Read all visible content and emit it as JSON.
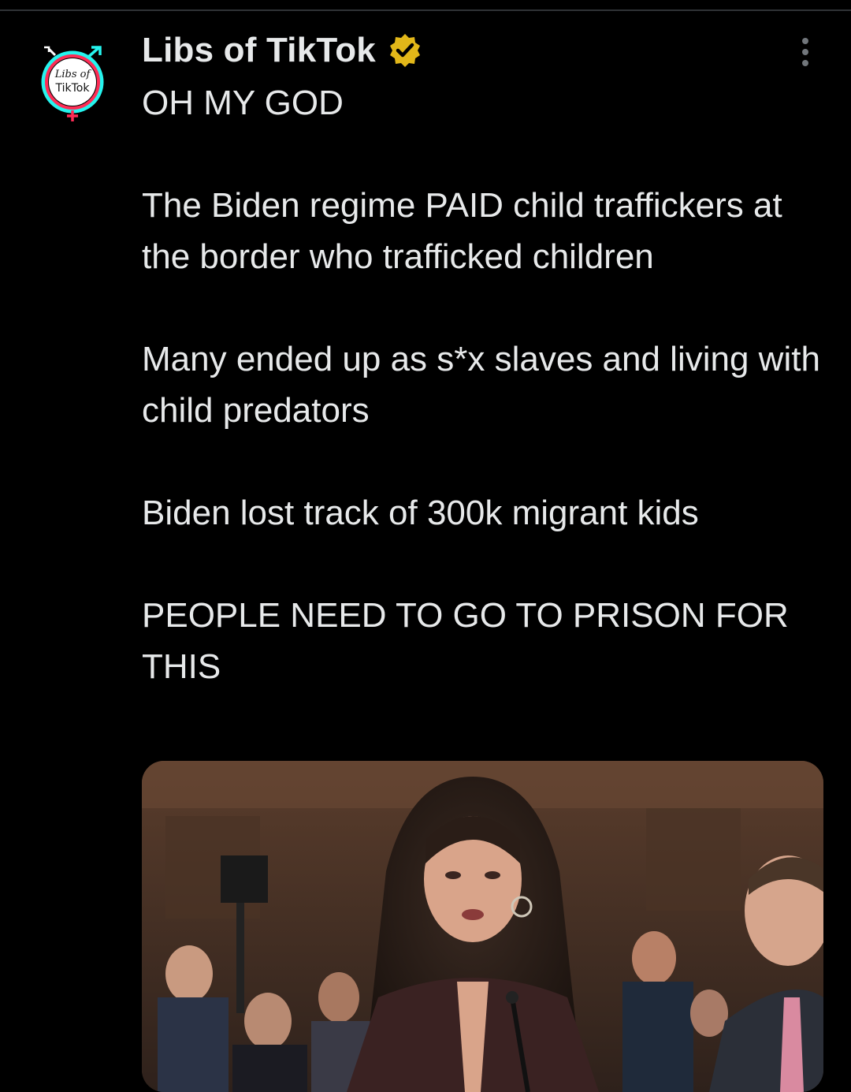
{
  "post": {
    "author": {
      "display_name": "Libs of TikTok",
      "avatar_text": [
        "Libs of",
        "TikTok"
      ],
      "verified": true
    },
    "paragraphs": [
      "OH MY GOD",
      "The Biden regime PAID child traffickers at the border who trafficked children",
      "Many ended up as s*x slaves and living with child predators",
      "Biden lost track of 300k migrant kids",
      "PEOPLE NEED TO GO TO PRISON FOR THIS"
    ]
  },
  "icons": {
    "verified": "verified-badge-icon",
    "more": "more-options-icon"
  },
  "colors": {
    "background": "#000000",
    "text": "#e7e9ea",
    "verified_badge": "#e2b719",
    "avatar_cyan": "#25f4ee",
    "avatar_pink": "#fe2c55"
  }
}
